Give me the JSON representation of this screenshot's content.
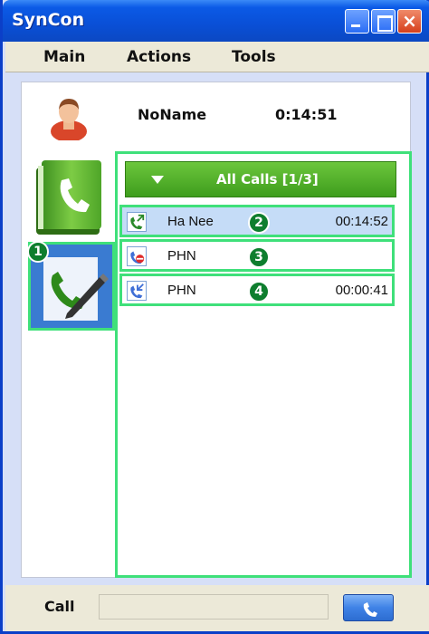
{
  "window": {
    "title": "SynCon"
  },
  "menu": {
    "main": "Main",
    "actions": "Actions",
    "tools": "Tools"
  },
  "user": {
    "name": "NoName",
    "elapsed": "0:14:51"
  },
  "sidebar": {
    "badge": "1"
  },
  "calls": {
    "header": "All Calls [1/3]",
    "items": [
      {
        "name": "Ha Nee",
        "duration": "00:14:52",
        "badge": "2",
        "icon": "outgoing-call-icon",
        "selected": true
      },
      {
        "name": "PHN",
        "duration": "",
        "badge": "3",
        "icon": "missed-call-icon",
        "selected": false
      },
      {
        "name": "PHN",
        "duration": "00:00:41",
        "badge": "4",
        "icon": "incoming-call-icon",
        "selected": false
      }
    ]
  },
  "bottom": {
    "call_label": "Call",
    "call_input_value": ""
  },
  "colors": {
    "highlight": "#3fe07a",
    "title_bar": "#0b4fd6",
    "header_green": "#4eaa28",
    "badge_green": "#0e7e2e"
  }
}
